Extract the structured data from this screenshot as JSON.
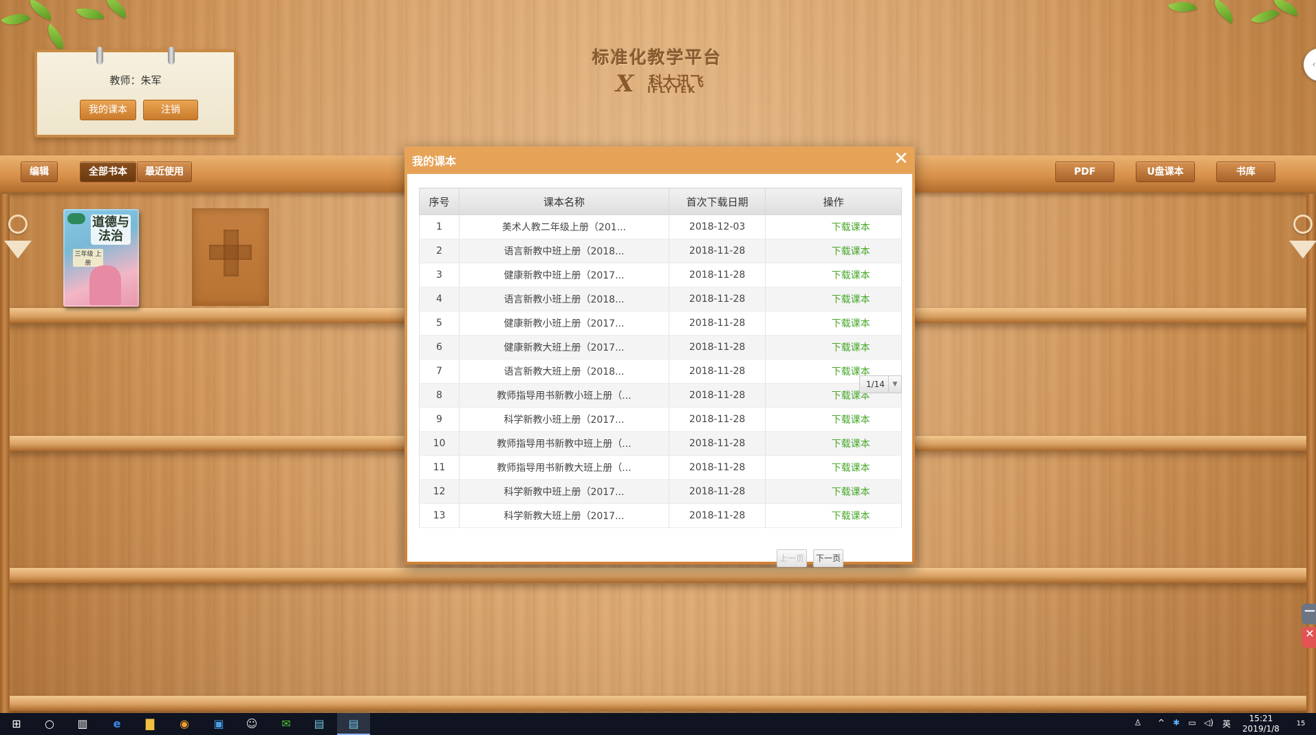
{
  "app": {
    "title": "标准化教学平台",
    "brand_cn": "科大讯飞",
    "brand_en": "IFLYTEK"
  },
  "teacher_card": {
    "teacher_label": "教师：朱军",
    "my_books_button": "我的课本",
    "logout_button": "注销"
  },
  "toolbar": {
    "edit": "编辑",
    "all_books": "全部书本",
    "recent": "最近使用",
    "pdf": "PDF",
    "usb_books": "U盘课本",
    "library": "书库"
  },
  "shelf": {
    "book_title": "道德与法治",
    "book_grade": "三年级 上册"
  },
  "modal": {
    "title": "我的课本",
    "close_glyph": "✕",
    "columns": [
      "序号",
      "课本名称",
      "首次下载日期",
      "操作"
    ],
    "rows": [
      {
        "idx": "1",
        "name": "美术人教二年级上册（201...",
        "date": "2018-12-03",
        "op": "下载课本"
      },
      {
        "idx": "2",
        "name": "语言新教中班上册（2018...",
        "date": "2018-11-28",
        "op": "下载课本"
      },
      {
        "idx": "3",
        "name": "健康新教中班上册（2017...",
        "date": "2018-11-28",
        "op": "下载课本"
      },
      {
        "idx": "4",
        "name": "语言新教小班上册（2018...",
        "date": "2018-11-28",
        "op": "下载课本"
      },
      {
        "idx": "5",
        "name": "健康新教小班上册（2017...",
        "date": "2018-11-28",
        "op": "下载课本"
      },
      {
        "idx": "6",
        "name": "健康新教大班上册（2017...",
        "date": "2018-11-28",
        "op": "下载课本"
      },
      {
        "idx": "7",
        "name": "语言新教大班上册（2018...",
        "date": "2018-11-28",
        "op": "下载课本"
      },
      {
        "idx": "8",
        "name": "教师指导用书新教小班上册（...",
        "date": "2018-11-28",
        "op": "下载课本"
      },
      {
        "idx": "9",
        "name": "科学新教小班上册（2017...",
        "date": "2018-11-28",
        "op": "下载课本"
      },
      {
        "idx": "10",
        "name": "教师指导用书新教中班上册（...",
        "date": "2018-11-28",
        "op": "下载课本"
      },
      {
        "idx": "11",
        "name": "教师指导用书新教大班上册（...",
        "date": "2018-11-28",
        "op": "下载课本"
      },
      {
        "idx": "12",
        "name": "科学新教中班上册（2017...",
        "date": "2018-11-28",
        "op": "下载课本"
      },
      {
        "idx": "13",
        "name": "科学新教大班上册（2017...",
        "date": "2018-11-28",
        "op": "下载课本"
      }
    ],
    "pager": {
      "prev": "上一页",
      "next": "下一页",
      "page": "1/14"
    }
  },
  "taskbar": {
    "ime": "英",
    "time": "15:21",
    "date": "2019/1/8",
    "notification_count": "15"
  },
  "colors": {
    "wood": "#d6a06a",
    "modal_header": "#e7a458",
    "download_link": "#48a82c"
  }
}
